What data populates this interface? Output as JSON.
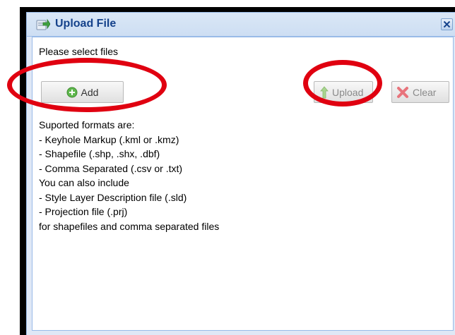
{
  "dialog": {
    "title": "Upload File",
    "prompt": "Please select files"
  },
  "toolbar": {
    "add_label": "Add",
    "upload_label": "Upload",
    "clear_label": "Clear"
  },
  "info_lines": [
    "Suported formats are:",
    "- Keyhole Markup (.kml or .kmz)",
    "- Shapefile (.shp, .shx, .dbf)",
    "- Comma Separated (.csv or .txt)",
    "You can also include",
    "- Style Layer Description file (.sld)",
    "- Projection file (.prj)",
    "for shapefiles and comma separated files"
  ],
  "icons": {
    "title": "upload-file-icon",
    "close": "close-icon",
    "add": "add-circle-icon",
    "upload": "up-arrow-icon",
    "clear": "red-x-icon"
  },
  "colors": {
    "title_text": "#15428b",
    "annotation": "#e00010",
    "dialog_border": "#99bbe8"
  }
}
